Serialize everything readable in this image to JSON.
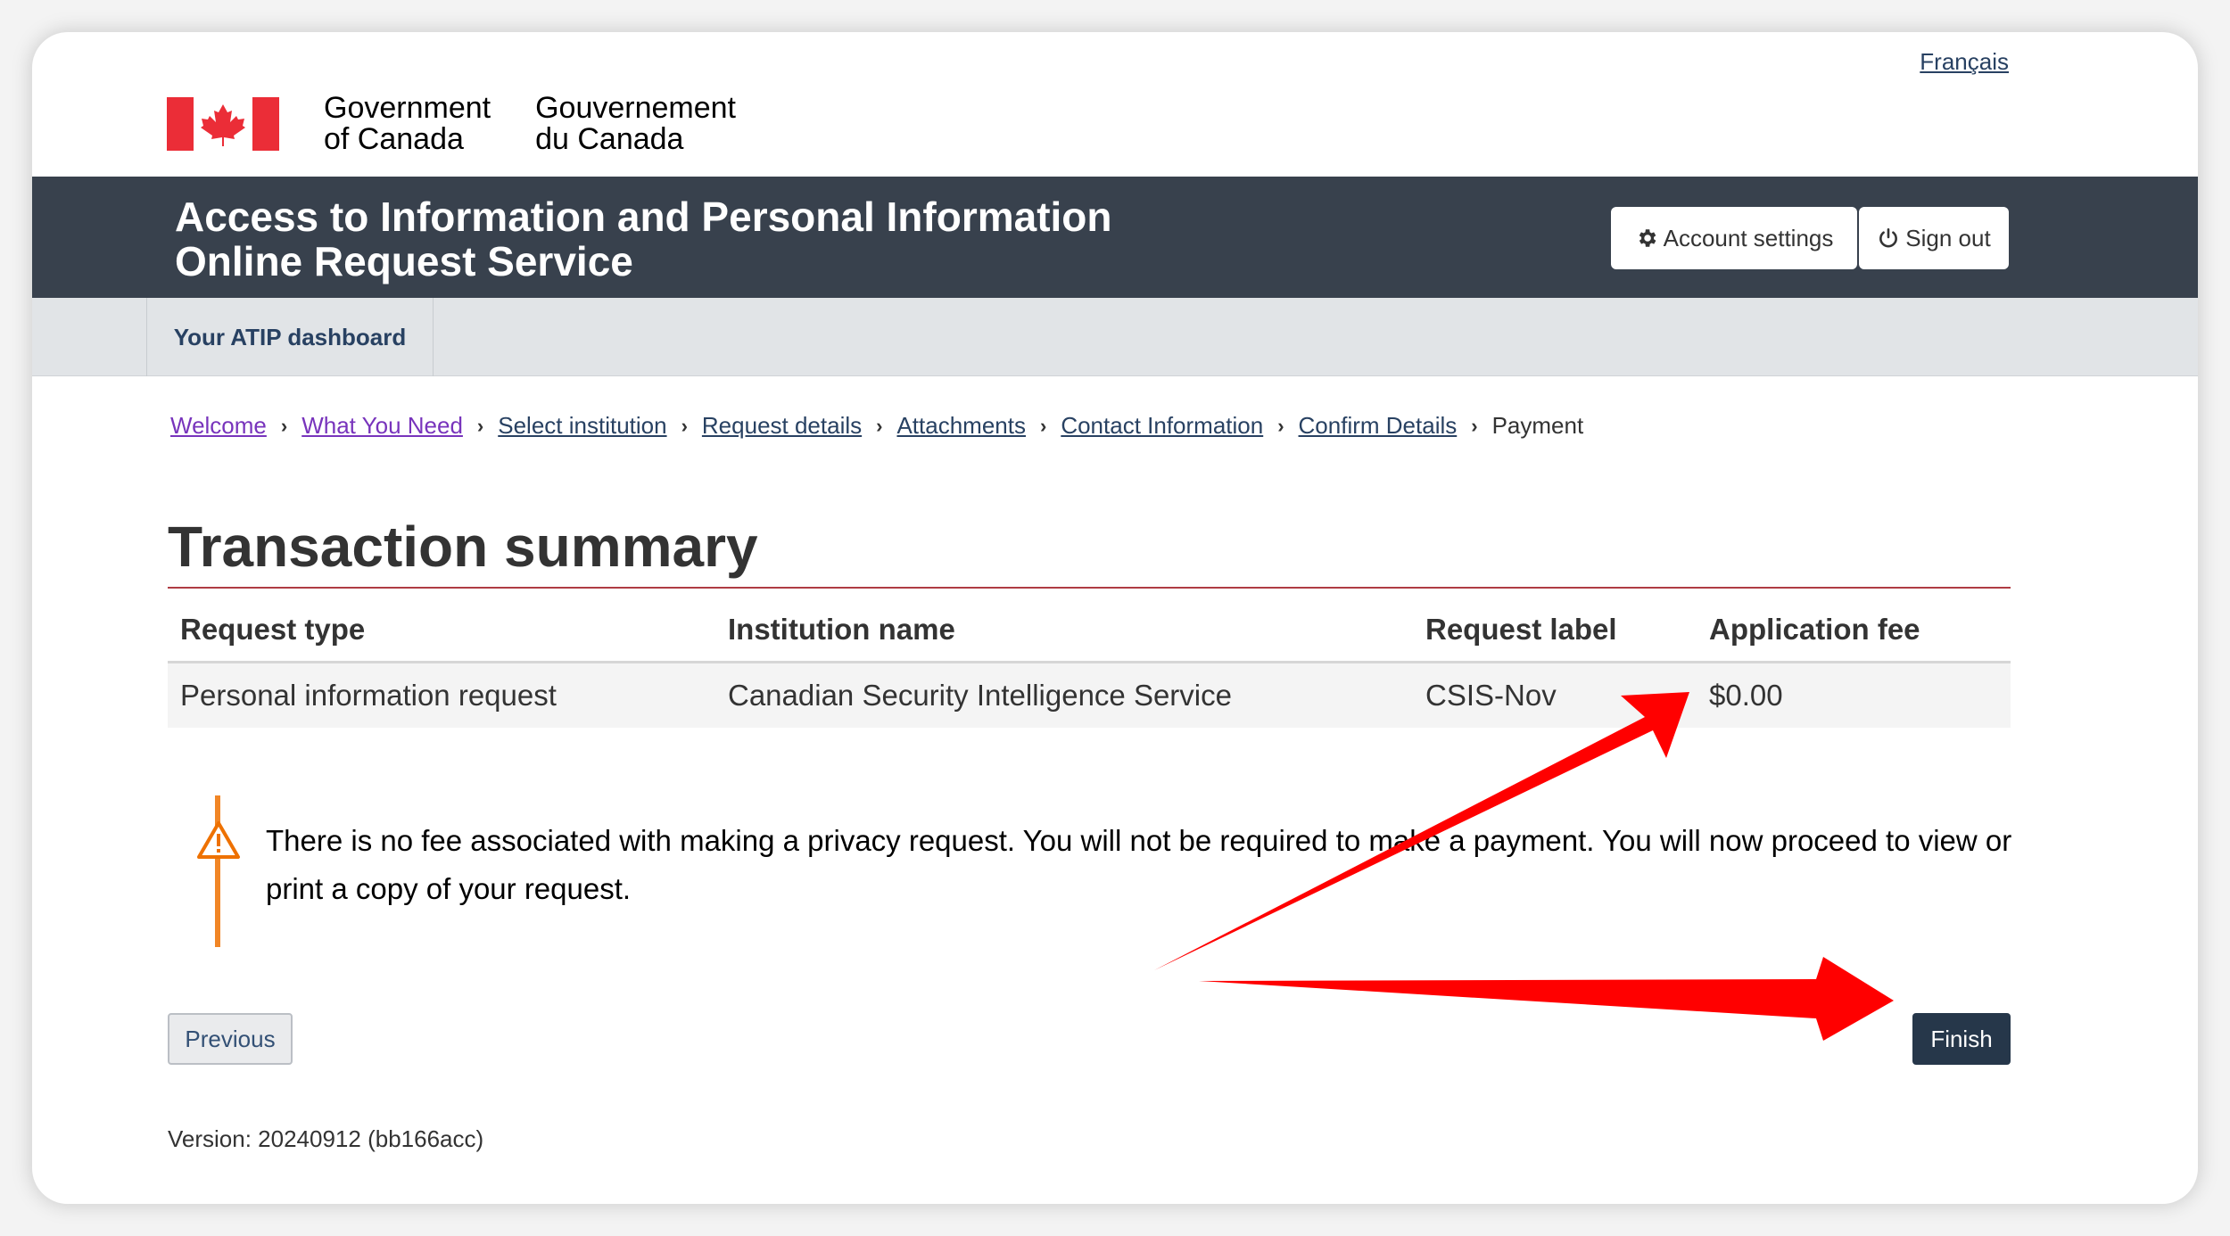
{
  "header": {
    "language_toggle": "Français",
    "signature": {
      "en_line1": "Government",
      "en_line2": "of Canada",
      "fr_line1": "Gouvernement",
      "fr_line2": "du Canada"
    }
  },
  "app_bar": {
    "title_line1": "Access to Information and Personal Information",
    "title_line2": "Online Request Service",
    "account_settings": "Account settings",
    "sign_out": "Sign out"
  },
  "nav": {
    "dashboard": "Your ATIP dashboard"
  },
  "breadcrumbs": [
    {
      "label": "Welcome"
    },
    {
      "label": "What You Need"
    },
    {
      "label": "Select institution"
    },
    {
      "label": "Request details"
    },
    {
      "label": "Attachments"
    },
    {
      "label": "Contact Information"
    },
    {
      "label": "Confirm Details"
    },
    {
      "label": "Payment"
    }
  ],
  "page_title": "Transaction summary",
  "table": {
    "headers": [
      "Request type",
      "Institution name",
      "Request label",
      "Application fee"
    ],
    "rows": [
      [
        "Personal information request",
        "Canadian Security Intelligence Service",
        "CSIS-Nov",
        "$0.00"
      ]
    ]
  },
  "notice": {
    "text": "There is no fee associated with making a privacy request. You will not be required to make a payment. You will now proceed to view or print a copy of your request."
  },
  "buttons": {
    "previous": "Previous",
    "finish": "Finish"
  },
  "version": "Version: 20240912 (bb166acc)",
  "colors": {
    "app_bar": "#38414d",
    "link": "#284162",
    "visited_link": "#7834bc",
    "title_rule": "#af3c43",
    "warning": "#ee7100",
    "finish_button": "#26374a",
    "annotation_arrow": "#ff0000"
  }
}
